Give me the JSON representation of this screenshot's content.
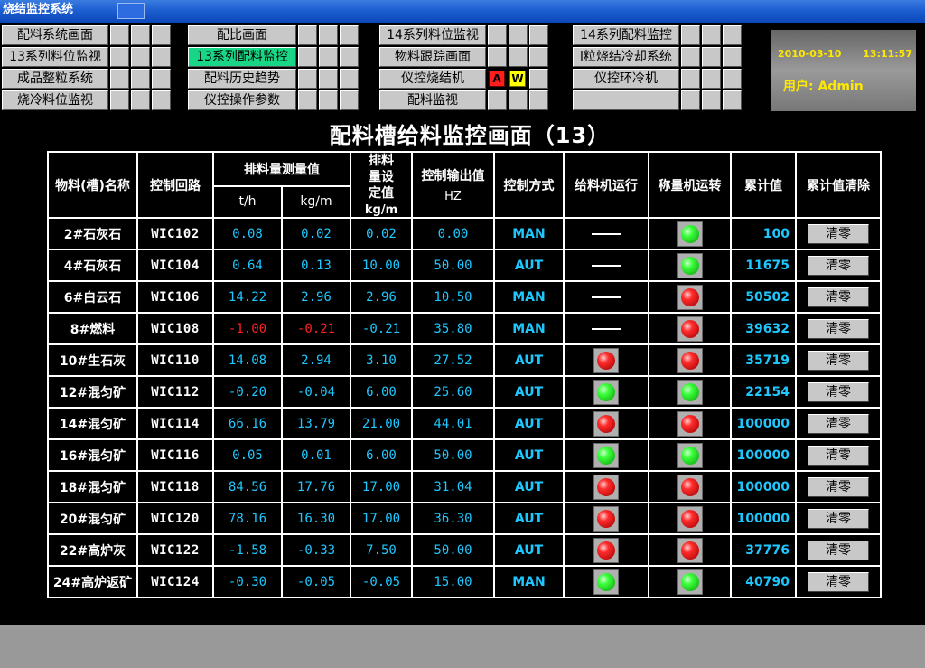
{
  "window": {
    "title": "烧结监控系统"
  },
  "nav": {
    "group1": [
      "配料系统画面",
      "13系列料位监视",
      "成品整粒系统",
      "烧冷料位监视"
    ],
    "group2": [
      "配比画面",
      "13系列配料监控",
      "配料历史趋势",
      "仪控操作参数"
    ],
    "group3": [
      "14系列料位监视",
      "物料跟踪画面",
      "仪控烧结机",
      "配料监视"
    ],
    "group4": [
      "14系列配料监控",
      "l粒烧结冷却系统",
      "仪控环冷机",
      ""
    ],
    "alarm_a": "A",
    "alarm_w": "W"
  },
  "info": {
    "date": "2010-03-10",
    "time": "13:11:57",
    "user": "用户:  Admin"
  },
  "page_title": "配料槽给料监控画面（13）",
  "table": {
    "headers": {
      "name": "物料(槽)名称",
      "loop": "控制回路",
      "measure_group": "排料量测量值",
      "tph": "t/h",
      "kgm": "kg/m",
      "setpoint": "排料量设定值",
      "setpoint_unit": "kg/m",
      "output": "控制输出值",
      "output_unit": "HZ",
      "mode": "控制方式",
      "feeder": "给料机运行",
      "scale": "称量机运转",
      "sum": "累计值",
      "clear": "累计值清除"
    },
    "clear_label": "清零",
    "rows": [
      {
        "name": "2#石灰石",
        "loop": "WIC102",
        "tph": "0.08",
        "kgm": "0.02",
        "set": "0.02",
        "out": "0.00",
        "mode": "MAN",
        "feeder": "none",
        "scale": "green",
        "sum": "100",
        "tph_neg": false,
        "kgm_neg": false
      },
      {
        "name": "4#石灰石",
        "loop": "WIC104",
        "tph": "0.64",
        "kgm": "0.13",
        "set": "10.00",
        "out": "50.00",
        "mode": "AUT",
        "feeder": "none",
        "scale": "green",
        "sum": "11675",
        "tph_neg": false,
        "kgm_neg": false
      },
      {
        "name": "6#白云石",
        "loop": "WIC106",
        "tph": "14.22",
        "kgm": "2.96",
        "set": "2.96",
        "out": "10.50",
        "mode": "MAN",
        "feeder": "none",
        "scale": "red",
        "sum": "50502",
        "tph_neg": false,
        "kgm_neg": false
      },
      {
        "name": "8#燃料",
        "loop": "WIC108",
        "tph": "-1.00",
        "kgm": "-0.21",
        "set": "-0.21",
        "out": "35.80",
        "mode": "MAN",
        "feeder": "none",
        "scale": "red",
        "sum": "39632",
        "tph_neg": true,
        "kgm_neg": true
      },
      {
        "name": "10#生石灰",
        "loop": "WIC110",
        "tph": "14.08",
        "kgm": "2.94",
        "set": "3.10",
        "out": "27.52",
        "mode": "AUT",
        "feeder": "red",
        "scale": "red",
        "sum": "35719",
        "tph_neg": false,
        "kgm_neg": false
      },
      {
        "name": "12#混匀矿",
        "loop": "WIC112",
        "tph": "-0.20",
        "kgm": "-0.04",
        "set": "6.00",
        "out": "25.60",
        "mode": "AUT",
        "feeder": "green",
        "scale": "green",
        "sum": "22154",
        "tph_neg": false,
        "kgm_neg": false
      },
      {
        "name": "14#混匀矿",
        "loop": "WIC114",
        "tph": "66.16",
        "kgm": "13.79",
        "set": "21.00",
        "out": "44.01",
        "mode": "AUT",
        "feeder": "red",
        "scale": "red",
        "sum": "100000",
        "tph_neg": false,
        "kgm_neg": false
      },
      {
        "name": "16#混匀矿",
        "loop": "WIC116",
        "tph": "0.05",
        "kgm": "0.01",
        "set": "6.00",
        "out": "50.00",
        "mode": "AUT",
        "feeder": "green",
        "scale": "green",
        "sum": "100000",
        "tph_neg": false,
        "kgm_neg": false
      },
      {
        "name": "18#混匀矿",
        "loop": "WIC118",
        "tph": "84.56",
        "kgm": "17.76",
        "set": "17.00",
        "out": "31.04",
        "mode": "AUT",
        "feeder": "red",
        "scale": "red",
        "sum": "100000",
        "tph_neg": false,
        "kgm_neg": false
      },
      {
        "name": "20#混匀矿",
        "loop": "WIC120",
        "tph": "78.16",
        "kgm": "16.30",
        "set": "17.00",
        "out": "36.30",
        "mode": "AUT",
        "feeder": "red",
        "scale": "red",
        "sum": "100000",
        "tph_neg": false,
        "kgm_neg": false
      },
      {
        "name": "22#高炉灰",
        "loop": "WIC122",
        "tph": "-1.58",
        "kgm": "-0.33",
        "set": "7.50",
        "out": "50.00",
        "mode": "AUT",
        "feeder": "red",
        "scale": "red",
        "sum": "37776",
        "tph_neg": false,
        "kgm_neg": false
      },
      {
        "name": "24#高炉返矿",
        "loop": "WIC124",
        "tph": "-0.30",
        "kgm": "-0.05",
        "set": "-0.05",
        "out": "15.00",
        "mode": "MAN",
        "feeder": "green",
        "scale": "green",
        "sum": "40790",
        "tph_neg": false,
        "kgm_neg": false
      }
    ]
  },
  "colors": {
    "value": "#1ec8ff",
    "negative": "#ff2020",
    "active_nav": "#19d686",
    "info_text": "#ffe800"
  }
}
